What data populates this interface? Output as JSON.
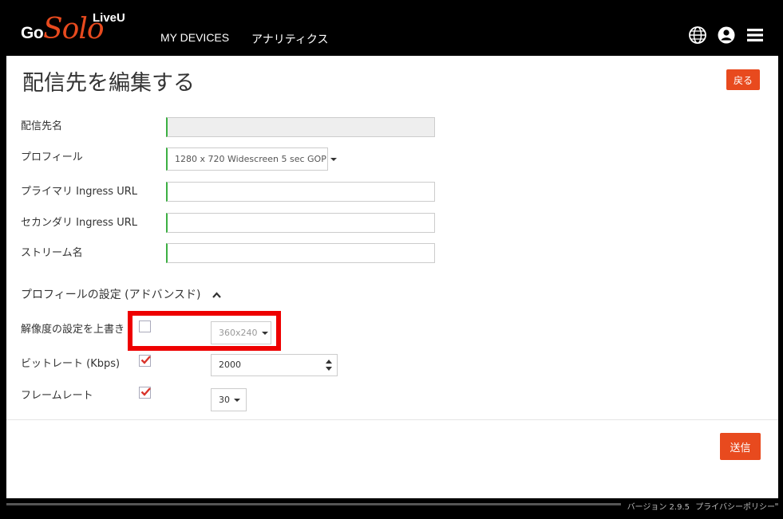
{
  "brand": {
    "go": "Go",
    "solo": "Solo",
    "liveu": "LiveU"
  },
  "nav": {
    "devices": "MY DEVICES",
    "analytics": "アナリティクス"
  },
  "icons": {
    "globe": "globe-icon",
    "user": "user-icon",
    "menu": "menu-icon"
  },
  "page": {
    "title": "配信先を編集する",
    "back": "戻る"
  },
  "form": {
    "destination_name_label": "配信先名",
    "destination_name_value": "",
    "profile_label": "プロフィール",
    "profile_value": "1280 x 720 Widescreen 5 sec GOP",
    "primary_url_label": "プライマリ Ingress URL",
    "primary_url_value": "",
    "secondary_url_label": "セカンダリ Ingress URL",
    "secondary_url_value": "",
    "stream_name_label": "ストリーム名",
    "stream_name_value": ""
  },
  "advanced": {
    "title": "プロフィールの設定 (アドバンスド)",
    "resolution_label": "解像度の設定を上書き",
    "resolution_checked": false,
    "resolution_value": "360x240",
    "bitrate_label": "ビットレート (Kbps)",
    "bitrate_checked": true,
    "bitrate_value": "2000",
    "framerate_label": "フレームレート",
    "framerate_checked": true,
    "framerate_value": "30"
  },
  "actions": {
    "submit": "送信"
  },
  "footer": {
    "version": "バージョン 2.9.5",
    "privacy": "プライバシーポリシー"
  },
  "colors": {
    "accent": "#e84a1e",
    "valid": "#3cb043",
    "highlight": "#ee0000"
  }
}
